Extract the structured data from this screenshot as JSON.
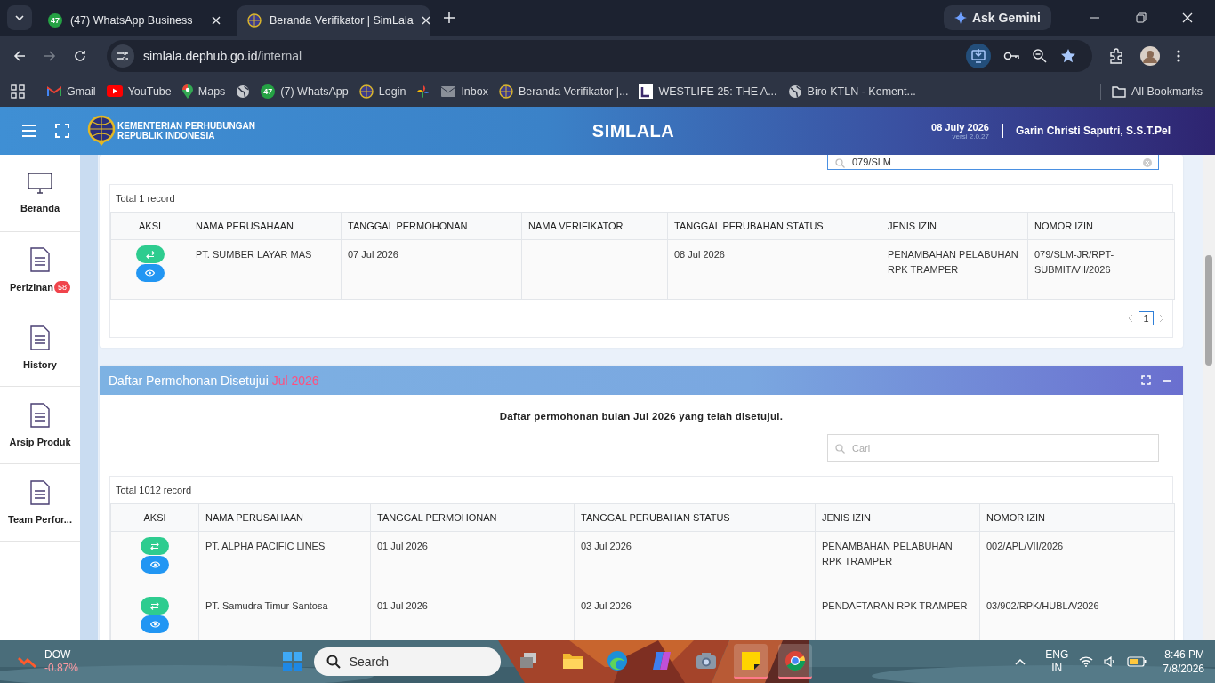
{
  "browser": {
    "tabs": [
      {
        "title": "(47) WhatsApp Business",
        "kind": "whatsapp",
        "icon_text": "47",
        "selected": false
      },
      {
        "title": "Beranda Verifikator | SimLala",
        "kind": "simlala",
        "selected": true
      }
    ],
    "ask_gemini": "Ask Gemini",
    "url_host": "simlala.dephub.go.id",
    "url_path": "/internal",
    "bookmarks": [
      {
        "kind": "gmail",
        "label": "Gmail"
      },
      {
        "kind": "youtube",
        "label": "YouTube"
      },
      {
        "kind": "maps",
        "label": "Maps"
      },
      {
        "kind": "globe"
      },
      {
        "kind": "whatsapp",
        "icon_text": "47",
        "label": "(7) WhatsApp"
      },
      {
        "kind": "simlala",
        "label": "Login"
      },
      {
        "kind": "photos"
      },
      {
        "kind": "mail",
        "label": "Inbox"
      },
      {
        "kind": "simlala",
        "label": "Beranda Verifikator |..."
      },
      {
        "kind": "square",
        "label": "WESTLIFE 25: THE A..."
      },
      {
        "kind": "globe",
        "label": "Biro KTLN - Kement..."
      }
    ],
    "all_bookmarks": "All Bookmarks"
  },
  "app": {
    "ministry": [
      "KEMENTERIAN PERHUBUNGAN",
      "REPUBLIK INDONESIA"
    ],
    "title": "SIMLALA",
    "date": "08 July 2026",
    "version": "versi 2.0.27",
    "user": "Garin Christi Saputri, S.S.T.Pel"
  },
  "sidebar": [
    {
      "label": "Beranda",
      "kind": "monitor"
    },
    {
      "label": "Perizinan",
      "kind": "document",
      "badge": "58"
    },
    {
      "label": "History",
      "kind": "document"
    },
    {
      "label": "Arsip Produk",
      "kind": "document"
    },
    {
      "label": "Team Perfor...",
      "kind": "document"
    }
  ],
  "panels": [
    {
      "search": {
        "value": "079/SLM"
      },
      "total": "Total 1 record",
      "columns": [
        "AKSI",
        "NAMA PERUSAHAAN",
        "TANGGAL PERMOHONAN",
        "NAMA VERIFIKATOR",
        "TANGGAL PERUBAHAN STATUS",
        "JENIS IZIN",
        "NOMOR IZIN"
      ],
      "rows": [
        {
          "cells": [
            "",
            "PT. SUMBER LAYAR MAS",
            "07 Jul 2026",
            "",
            "08 Jul 2026",
            "PENAMBAHAN PELABUHAN RPK TRAMPER",
            "079/SLM-JR/RPT-SUBMIT/VII/2026"
          ]
        }
      ],
      "pagination": [
        {
          "label": "1",
          "selected": true
        }
      ]
    },
    {
      "title": "Daftar Permohonan Disetujui",
      "title_highlight": "Jul 2026",
      "subtitle": "Daftar permohonan bulan Jul 2026 yang telah disetujui.",
      "search": {
        "placeholder": "Cari"
      },
      "total": "Total 1012 record",
      "columns": [
        "AKSI",
        "NAMA PERUSAHAAN",
        "TANGGAL PERMOHONAN",
        "TANGGAL PERUBAHAN STATUS",
        "JENIS IZIN",
        "NOMOR IZIN"
      ],
      "rows": [
        {
          "cells": [
            "",
            "PT. ALPHA PACIFIC LINES",
            "01 Jul 2026",
            "03 Jul 2026",
            "PENAMBAHAN PELABUHAN RPK TRAMPER",
            "002/APL/VII/2026"
          ]
        },
        {
          "cells": [
            "",
            "PT. Samudra Timur Santosa",
            "01 Jul 2026",
            "02 Jul 2026",
            "PENDAFTARAN RPK TRAMPER",
            "03/902/RPK/HUBLA/2026"
          ]
        }
      ]
    }
  ],
  "taskbar": {
    "ticker": {
      "name": "DOW",
      "change": "-0.87%"
    },
    "search": "Search",
    "apps": [
      {
        "kind": "taskview",
        "active": false
      },
      {
        "kind": "folder",
        "active": false
      },
      {
        "kind": "edge",
        "active": false
      },
      {
        "kind": "copilot",
        "active": false
      },
      {
        "kind": "camera",
        "active": false
      },
      {
        "kind": "notes",
        "active": true
      },
      {
        "kind": "chrome",
        "active": true
      }
    ],
    "lang": "ENG",
    "region": "IN",
    "time": "8:46 PM",
    "date": "7/8/2026"
  }
}
